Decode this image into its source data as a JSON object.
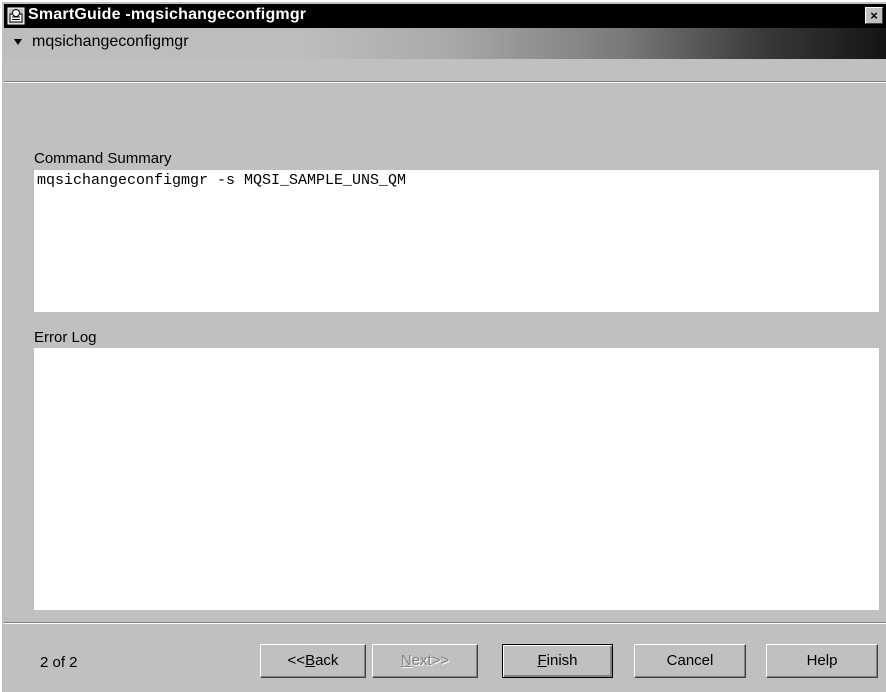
{
  "window": {
    "title": "SmartGuide -mqsichangeconfigmgr",
    "close_glyph": "×",
    "app_icon": "smartguide-icon"
  },
  "header": {
    "step_title": "mqsichangeconfigmgr"
  },
  "command_summary": {
    "label": "Command Summary",
    "value": "mqsichangeconfigmgr -s MQSI_SAMPLE_UNS_QM"
  },
  "error_log": {
    "label": "Error Log",
    "value": ""
  },
  "footer": {
    "page_counter": "2 of 2",
    "back_prefix": "<<",
    "back_mnemonic": "B",
    "back_rest": "ack",
    "next_mnemonic": "N",
    "next_rest": "ext>>",
    "finish_mnemonic": "F",
    "finish_rest": "inish",
    "cancel_label": "Cancel",
    "help_label": "Help"
  },
  "colors": {
    "titlebar": "#000000",
    "window": "#c0c0c0",
    "field": "#ffffff",
    "disabled_text": "#808080"
  }
}
